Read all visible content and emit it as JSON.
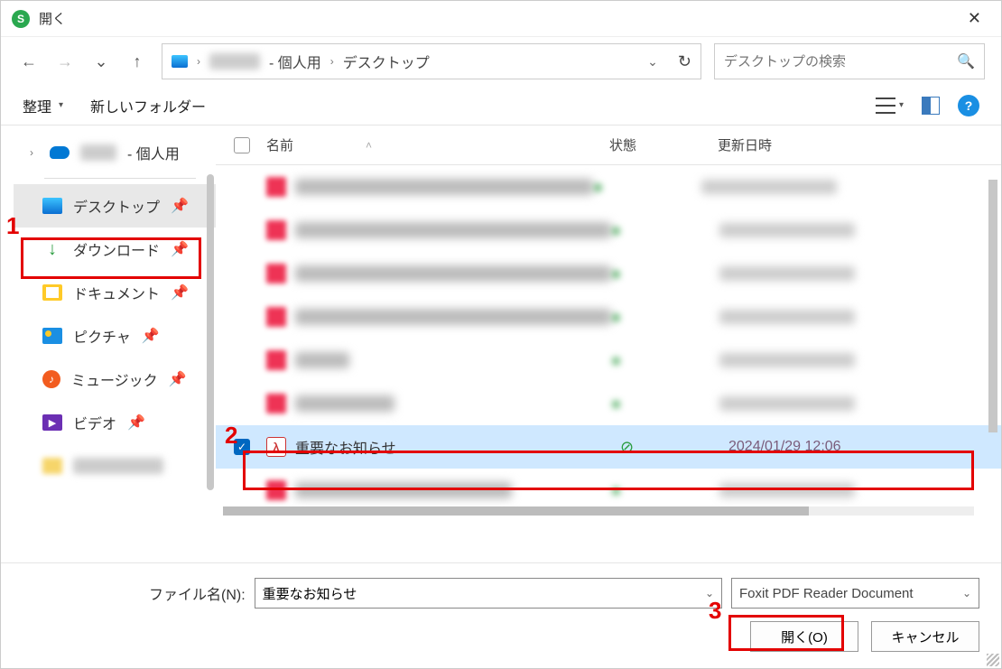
{
  "title": "開く",
  "breadcrumb": {
    "user_suffix": "- 個人用",
    "location": "デスクトップ"
  },
  "search": {
    "placeholder": "デスクトップの検索"
  },
  "toolbar": {
    "organize": "整理",
    "newfolder": "新しいフォルダー"
  },
  "sidebar": {
    "onedrive_suffix": "- 個人用",
    "items": [
      {
        "label": "デスクトップ"
      },
      {
        "label": "ダウンロード"
      },
      {
        "label": "ドキュメント"
      },
      {
        "label": "ピクチャ"
      },
      {
        "label": "ミュージック"
      },
      {
        "label": "ビデオ"
      }
    ]
  },
  "columns": {
    "name": "名前",
    "state": "状態",
    "date": "更新日時"
  },
  "selected_file": {
    "name": "重要なお知らせ",
    "date": "2024/01/29 12:06"
  },
  "footer": {
    "filename_label": "ファイル名(N):",
    "filename_value": "重要なお知らせ",
    "filetype": "Foxit PDF Reader Document",
    "open": "開く(O)",
    "cancel": "キャンセル"
  },
  "annotations": {
    "n1": "1",
    "n2": "2",
    "n3": "3"
  }
}
